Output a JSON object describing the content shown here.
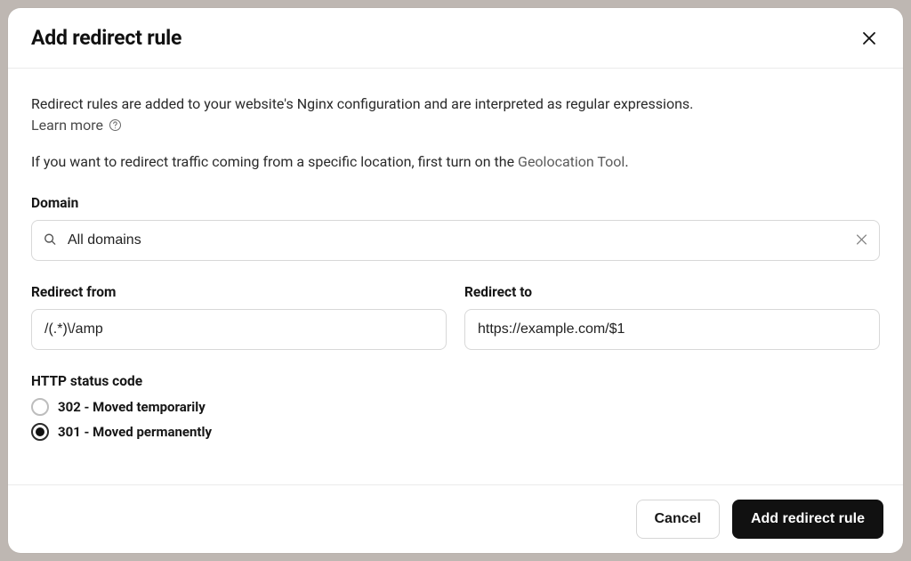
{
  "modal": {
    "title": "Add redirect rule",
    "description": "Redirect rules are added to your website's Nginx configuration and are interpreted as regular expressions.",
    "learn_more": "Learn more",
    "geo_line_prefix": "If you want to redirect traffic coming from a specific location, first turn on the ",
    "geo_link": "Geolocation Tool",
    "geo_line_suffix": "."
  },
  "form": {
    "domain": {
      "label": "Domain",
      "value": "All domains"
    },
    "redirect_from": {
      "label": "Redirect from",
      "value": "/(.*)\\/amp"
    },
    "redirect_to": {
      "label": "Redirect to",
      "value": "https://example.com/$1"
    },
    "status": {
      "label": "HTTP status code",
      "options": [
        {
          "value": "302",
          "label": "302 - Moved temporarily",
          "selected": false
        },
        {
          "value": "301",
          "label": "301 - Moved permanently",
          "selected": true
        }
      ]
    }
  },
  "footer": {
    "cancel": "Cancel",
    "submit": "Add redirect rule"
  }
}
